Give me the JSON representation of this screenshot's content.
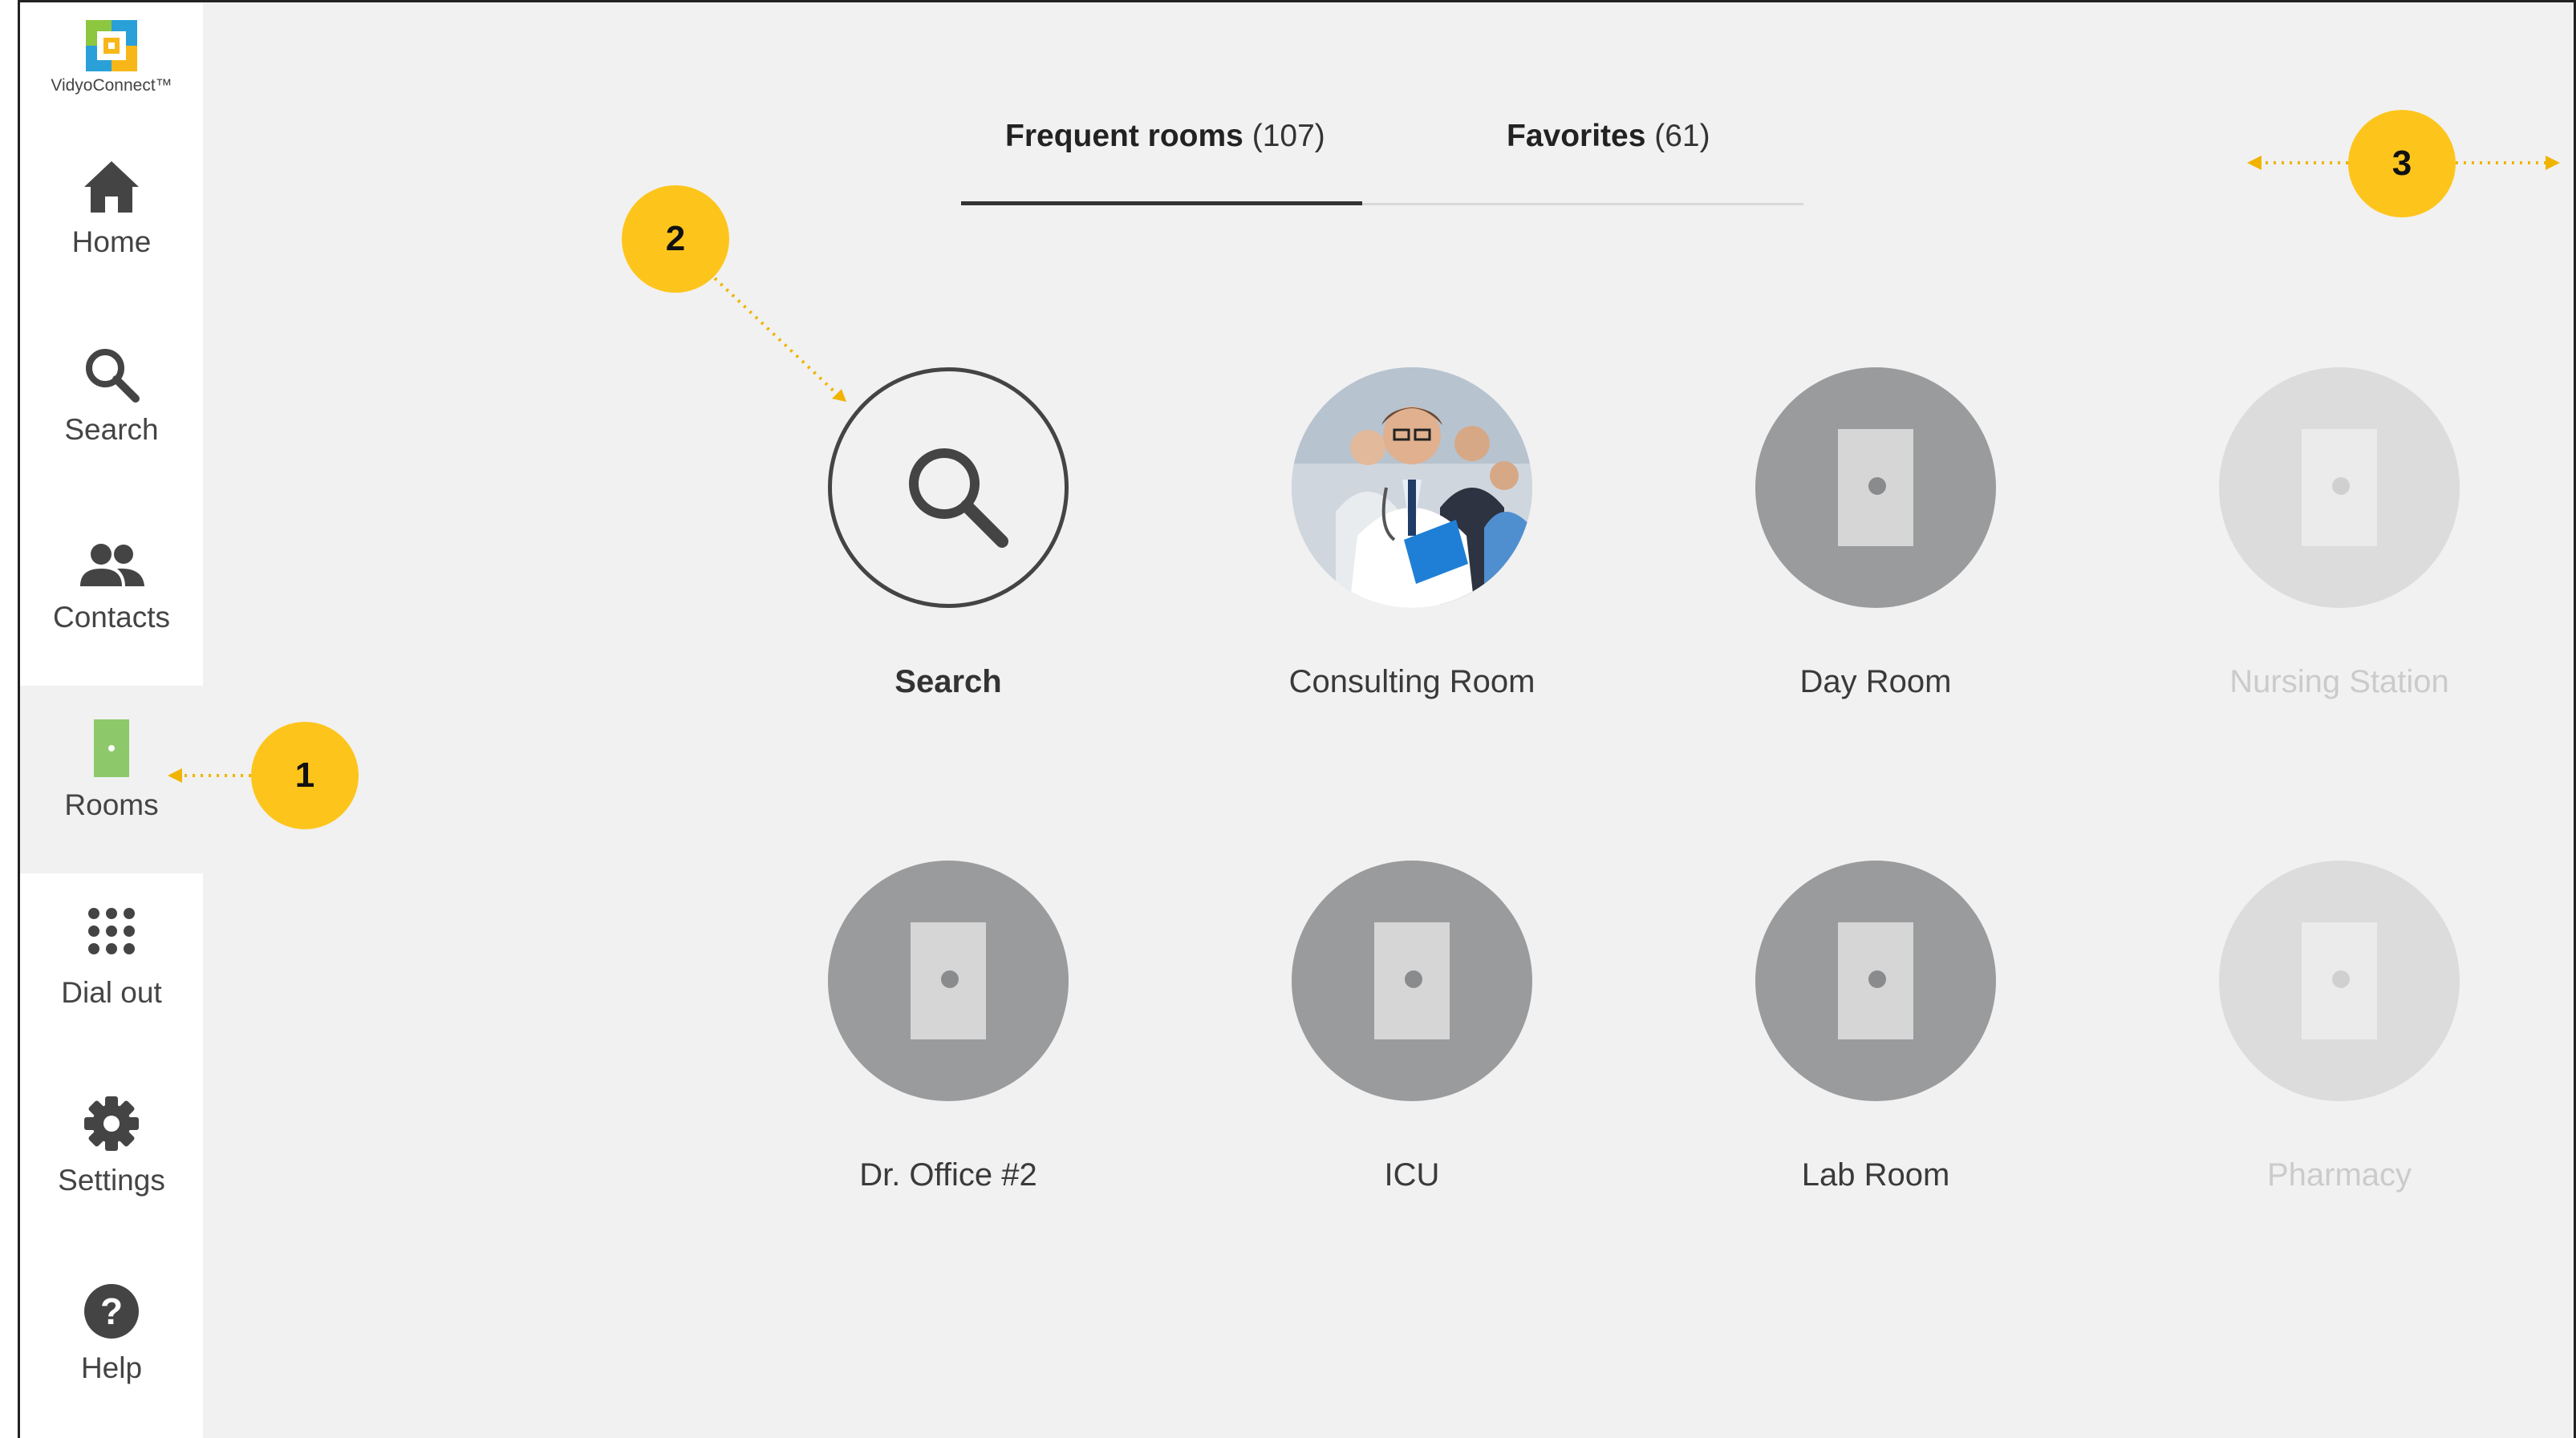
{
  "app": {
    "logo_text": "VidyoConnect™"
  },
  "sidebar": {
    "items": [
      {
        "key": "home",
        "label": "Home",
        "icon": "home-icon"
      },
      {
        "key": "search",
        "label": "Search",
        "icon": "search-icon"
      },
      {
        "key": "contacts",
        "label": "Contacts",
        "icon": "contacts-icon"
      },
      {
        "key": "rooms",
        "label": "Rooms",
        "icon": "door-icon",
        "active": true
      },
      {
        "key": "dialout",
        "label": "Dial out",
        "icon": "dialpad-icon"
      },
      {
        "key": "settings",
        "label": "Settings",
        "icon": "gear-icon"
      },
      {
        "key": "help",
        "label": "Help",
        "icon": "help-icon"
      }
    ]
  },
  "tabs": [
    {
      "name": "Frequent rooms",
      "count": "(107)",
      "active": true
    },
    {
      "name": "Favorites",
      "count": "(61)",
      "active": false
    }
  ],
  "rooms": [
    {
      "label": "Search",
      "kind": "search"
    },
    {
      "label": "Consulting Room",
      "kind": "photo"
    },
    {
      "label": "Day Room",
      "kind": "door"
    },
    {
      "label": "Nursing Station",
      "kind": "door",
      "dim": true
    },
    {
      "label": "Dr. Office #2",
      "kind": "door"
    },
    {
      "label": "ICU",
      "kind": "door"
    },
    {
      "label": "Lab Room",
      "kind": "door"
    },
    {
      "label": "Pharmacy",
      "kind": "door",
      "dim": true
    }
  ],
  "callouts": [
    "1",
    "2",
    "3"
  ],
  "colors": {
    "accent_callout": "#fdc51c",
    "rooms_active_icon": "#8dc96a",
    "sidebar_active_bg": "#f1f1f1",
    "main_bg": "#f1f1f1"
  }
}
